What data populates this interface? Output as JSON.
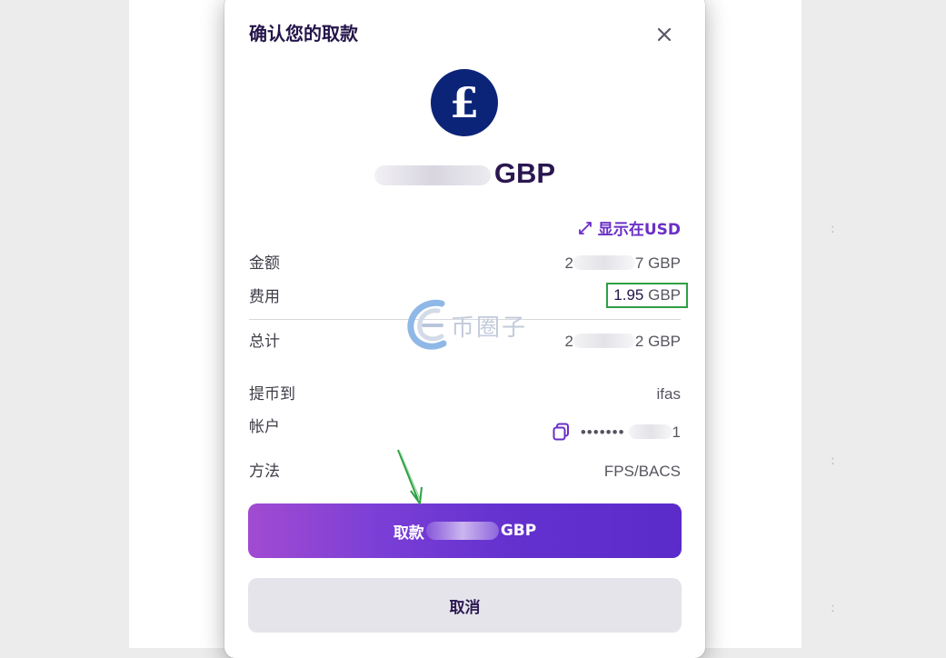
{
  "dialog": {
    "title": "确认您的取款",
    "close_icon": "close-icon",
    "currency_icon": "pound-sign-icon",
    "currency_symbol": "£",
    "amount_currency": "GBP",
    "show_usd_label": "显示在USD",
    "show_usd_icon": "swap-arrows-icon"
  },
  "details": {
    "amount": {
      "label": "金额",
      "suffix": "7 GBP",
      "prefix": "2"
    },
    "fee": {
      "label": "费用",
      "number": "1.95",
      "currency": "GBP"
    },
    "total": {
      "label": "总计",
      "suffix": "2 GBP",
      "prefix": "2"
    },
    "withdraw_to": {
      "label": "提币到",
      "value": "ifas"
    },
    "account": {
      "label": "帐户",
      "masked": "•••••••",
      "suffix": "1",
      "copy_icon": "copy-icon"
    },
    "method": {
      "label": "方法",
      "value": "FPS/BACS"
    }
  },
  "buttons": {
    "withdraw_prefix": "取款",
    "withdraw_suffix": "GBP",
    "cancel": "取消"
  },
  "watermark": {
    "text": "币圈子"
  },
  "colors": {
    "accent": "#6a2fc7",
    "title": "#24154a",
    "highlight_box": "#2ea043",
    "currency_badge": "#0c2478"
  }
}
